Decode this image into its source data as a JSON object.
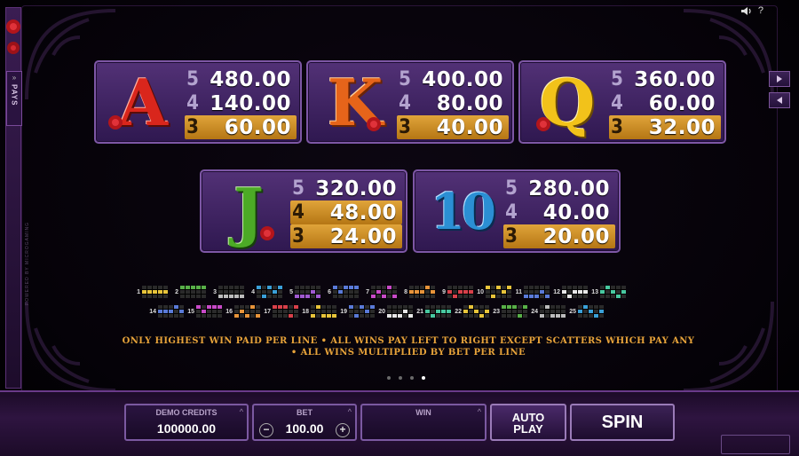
{
  "side_panel": {
    "tab_label": "PAYS",
    "tab_arrows": "»",
    "powered_by": "POWERED BY MICROGAMING"
  },
  "top_icons": {
    "sound_icon": "speaker-icon",
    "help": "?"
  },
  "paytable": [
    {
      "symbol": "A",
      "color": "#d9261c",
      "pays": [
        {
          "count": "5",
          "value": "480.00"
        },
        {
          "count": "4",
          "value": "140.00"
        },
        {
          "count": "3",
          "value": "60.00"
        }
      ]
    },
    {
      "symbol": "K",
      "color": "#e6641a",
      "pays": [
        {
          "count": "5",
          "value": "400.00"
        },
        {
          "count": "4",
          "value": "80.00"
        },
        {
          "count": "3",
          "value": "40.00"
        }
      ]
    },
    {
      "symbol": "Q",
      "color": "#f2c21a",
      "pays": [
        {
          "count": "5",
          "value": "360.00"
        },
        {
          "count": "4",
          "value": "60.00"
        },
        {
          "count": "3",
          "value": "32.00"
        }
      ]
    },
    {
      "symbol": "J",
      "color": "#4caa26",
      "pays": [
        {
          "count": "5",
          "value": "320.00"
        },
        {
          "count": "4",
          "value": "48.00"
        },
        {
          "count": "3",
          "value": "24.00"
        }
      ]
    },
    {
      "symbol": "10",
      "color": "#2b8fd4",
      "pays": [
        {
          "count": "5",
          "value": "280.00"
        },
        {
          "count": "4",
          "value": "40.00"
        },
        {
          "count": "3",
          "value": "20.00"
        }
      ]
    }
  ],
  "paylines": {
    "row1": [
      "1",
      "2",
      "3",
      "4",
      "5",
      "6",
      "7",
      "8",
      "9",
      "10",
      "11",
      "12",
      "13"
    ],
    "row2": [
      "14",
      "15",
      "16",
      "17",
      "18",
      "19",
      "20",
      "21",
      "22",
      "23",
      "24",
      "25"
    ]
  },
  "rules": {
    "line1": "ONLY HIGHEST WIN PAID PER LINE  • ALL WINS PAY LEFT TO RIGHT EXCEPT SCATTERS WHICH PAY ANY",
    "line2": "• ALL WINS MULTIPLIED BY BET PER LINE"
  },
  "page_indicator": {
    "pages": 4,
    "active": 4
  },
  "controls": {
    "credits_label": "DEMO CREDITS",
    "credits_value": "100000.00",
    "bet_label": "BET",
    "bet_value": "100.00",
    "bet_minus": "−",
    "bet_plus": "+",
    "win_label": "WIN",
    "win_value": "",
    "autoplay_label_1": "AUTO",
    "autoplay_label_2": "PLAY",
    "spin_label": "SPIN"
  }
}
